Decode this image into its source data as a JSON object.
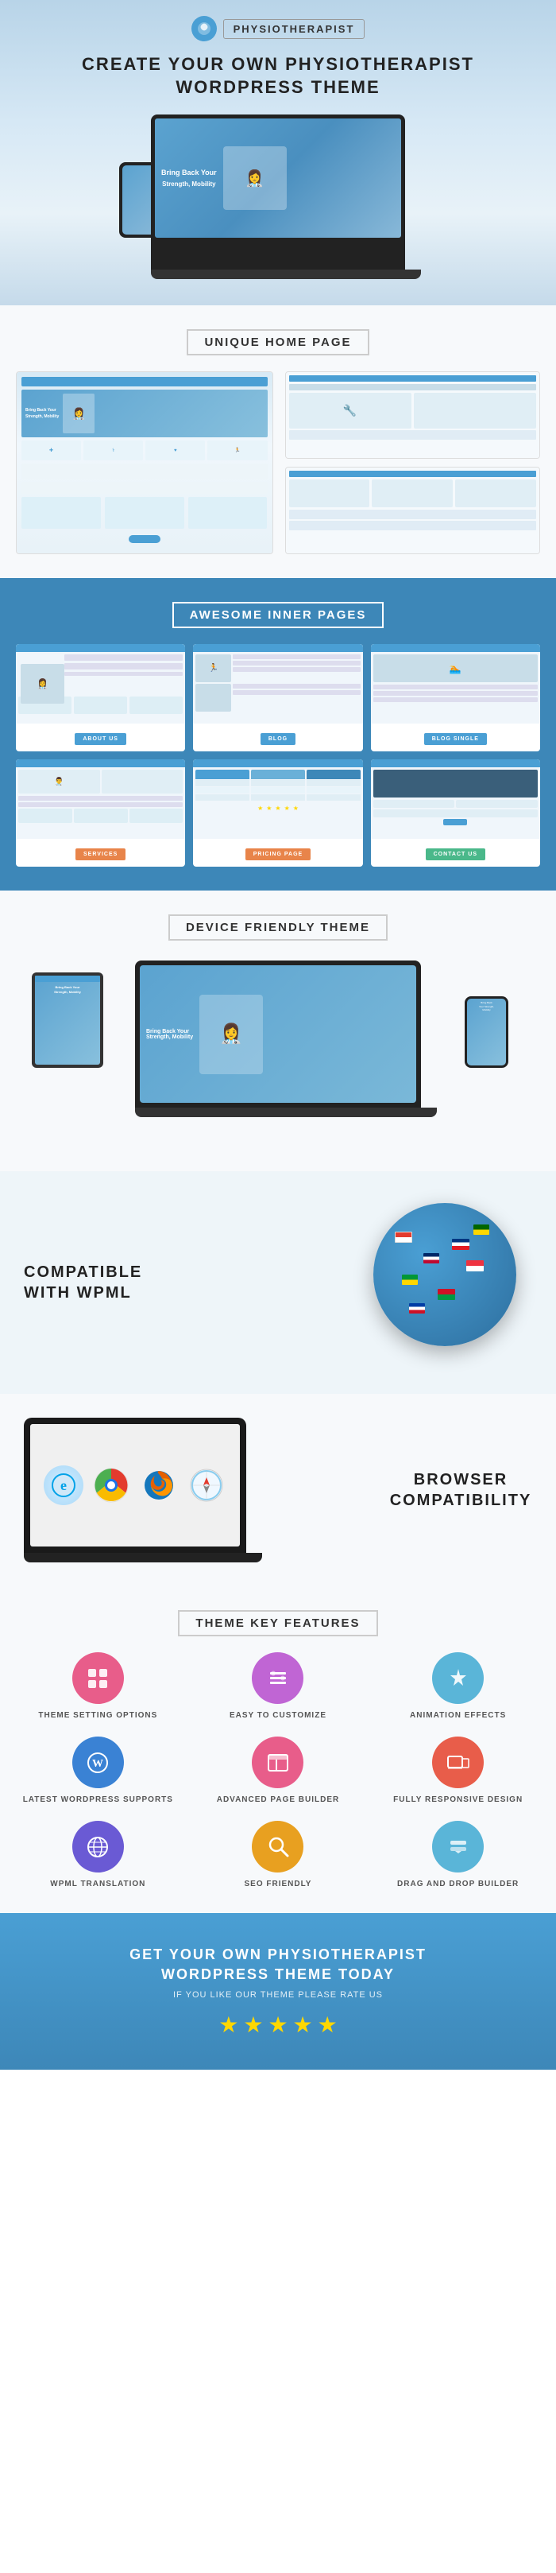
{
  "header": {
    "logo_text": "PHYSIOTHERAPIST",
    "logo_icon": "🌿",
    "hero_title_line1": "CREATE YOUR OWN PHYSIOTHERAPIST",
    "hero_title_line2": "WORDPRESS THEME"
  },
  "sections": {
    "unique_home": {
      "title": "UNIQUE HOME PAGE"
    },
    "inner_pages": {
      "title": "AWESOME INNER PAGES",
      "buttons": [
        "ABOUT US",
        "BLOG",
        "BLOG SINGLE",
        "SERVICES",
        "PRICING PAGE",
        "CONTACT US"
      ]
    },
    "device_friendly": {
      "title": "DEVICE FRIENDLY THEME"
    },
    "wpml": {
      "title_line1": "COMPATIBLE",
      "title_line2": "WITH WPML"
    },
    "browser": {
      "title_line1": "BROWSER",
      "title_line2": "COMPATIBILITY"
    },
    "features": {
      "title": "THEME KEY FEATURES",
      "items": [
        {
          "label": "THEME SETTING OPTIONS",
          "color": "#e85d8a",
          "icon": "⚙️"
        },
        {
          "label": "EASY TO CUSTOMIZE",
          "color": "#c065d4",
          "icon": "🎨"
        },
        {
          "label": "ANIMATION EFFECTS",
          "color": "#5ab5d8",
          "icon": "✨"
        },
        {
          "label": "LATEST WORDPRESS SUPPORTS",
          "color": "#3a82d4",
          "icon": "🔧"
        },
        {
          "label": "ADVANCED PAGE BUILDER",
          "color": "#e85d8a",
          "icon": "📐"
        },
        {
          "label": "FULLY RESPONSIVE DESIGN",
          "color": "#e85d4a",
          "icon": "📱"
        },
        {
          "label": "WPML TRANSLATION",
          "color": "#6a5ad4",
          "icon": "🌐"
        },
        {
          "label": "SEO FRIENDLY",
          "color": "#e8a020",
          "icon": "🔍"
        },
        {
          "label": "DRAG AND DROP BUILDER",
          "color": "#5ab5d8",
          "icon": "⬇️"
        }
      ]
    },
    "cta": {
      "title_line1": "GET YOUR OWN PHYSIOTHERAPIST",
      "title_line2": "WORDPRESS THEME TODAY",
      "subtitle": "IF YOU LIKE OUR THEME PLEASE RATE US",
      "stars": [
        "★",
        "★",
        "★",
        "★",
        "★"
      ]
    }
  },
  "laptop_screen": {
    "title": "Bring Back Your",
    "subtitle": "Strength, Mobility"
  },
  "browser_icons": [
    {
      "name": "Internet Explorer",
      "symbol": "e",
      "color": "#00a2e8"
    },
    {
      "name": "Chrome",
      "symbol": "●",
      "color": "#e33b2e"
    },
    {
      "name": "Firefox",
      "symbol": "🦊",
      "color": "#e66000"
    },
    {
      "name": "Safari",
      "symbol": "◎",
      "color": "#0fb5ee"
    }
  ]
}
